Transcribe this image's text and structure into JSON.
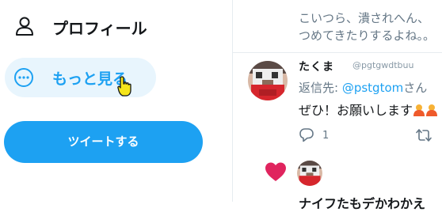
{
  "nav": {
    "profile_label": "プロフィール",
    "profile_icon": "person-icon",
    "more_label": "もっと見る",
    "more_icon": "more-circle-icon",
    "tweet_button_label": "ツイートする"
  },
  "timeline": {
    "previous_tweet_lines": "こいつら、潰されへん、\nつめてきたりするよね。。",
    "tweet": {
      "display_name": "たくま",
      "handle": "@pgtgwdtbuu",
      "reply_prefix": "返信先: ",
      "reply_mention": "@pstgtom",
      "reply_suffix": "さん",
      "text": "ぜひ！お願いします",
      "reply_count": "1"
    },
    "bottom_name": "ナイフたもデかわかえ"
  },
  "colors": {
    "accent": "#1da1f2",
    "hover_bg": "#e8f5fd",
    "like": "#e0245e",
    "muted": "#657786"
  }
}
